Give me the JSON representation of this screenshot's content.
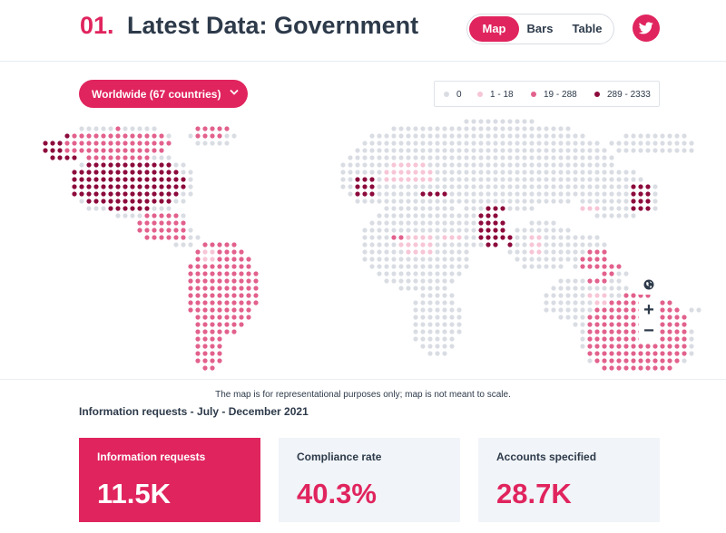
{
  "header": {
    "number": "01.",
    "title": "Latest Data: Government"
  },
  "view_toggle": {
    "map": "Map",
    "bars": "Bars",
    "table": "Table",
    "selected": "Map"
  },
  "social": {
    "icon": "twitter-icon"
  },
  "region_selector": {
    "label": "Worldwide (67 countries)",
    "icon": "chevron-down-icon"
  },
  "legend": [
    {
      "label": "0",
      "color": "#d9dde3"
    },
    {
      "label": "1 - 18",
      "color": "#f7c6d6"
    },
    {
      "label": "19 - 288",
      "color": "#e2618d"
    },
    {
      "label": "289 - 2333",
      "color": "#8c0a3c"
    }
  ],
  "map_controls": {
    "reset": "globe-icon",
    "zoom_in": "+",
    "zoom_out": "−"
  },
  "disclaimer": "The map is for representational purposes only; map is not meant to scale.",
  "period_title": "Information requests - July - December 2021",
  "stats": [
    {
      "label": "Information requests",
      "value": "11.5K",
      "active": true
    },
    {
      "label": "Compliance rate",
      "value": "40.3%",
      "active": false
    },
    {
      "label": "Accounts specified",
      "value": "28.7K",
      "active": false
    }
  ],
  "colors": {
    "accent": "#e0245e",
    "text": "#2d3a4a",
    "card_bg": "#f1f4f8"
  }
}
